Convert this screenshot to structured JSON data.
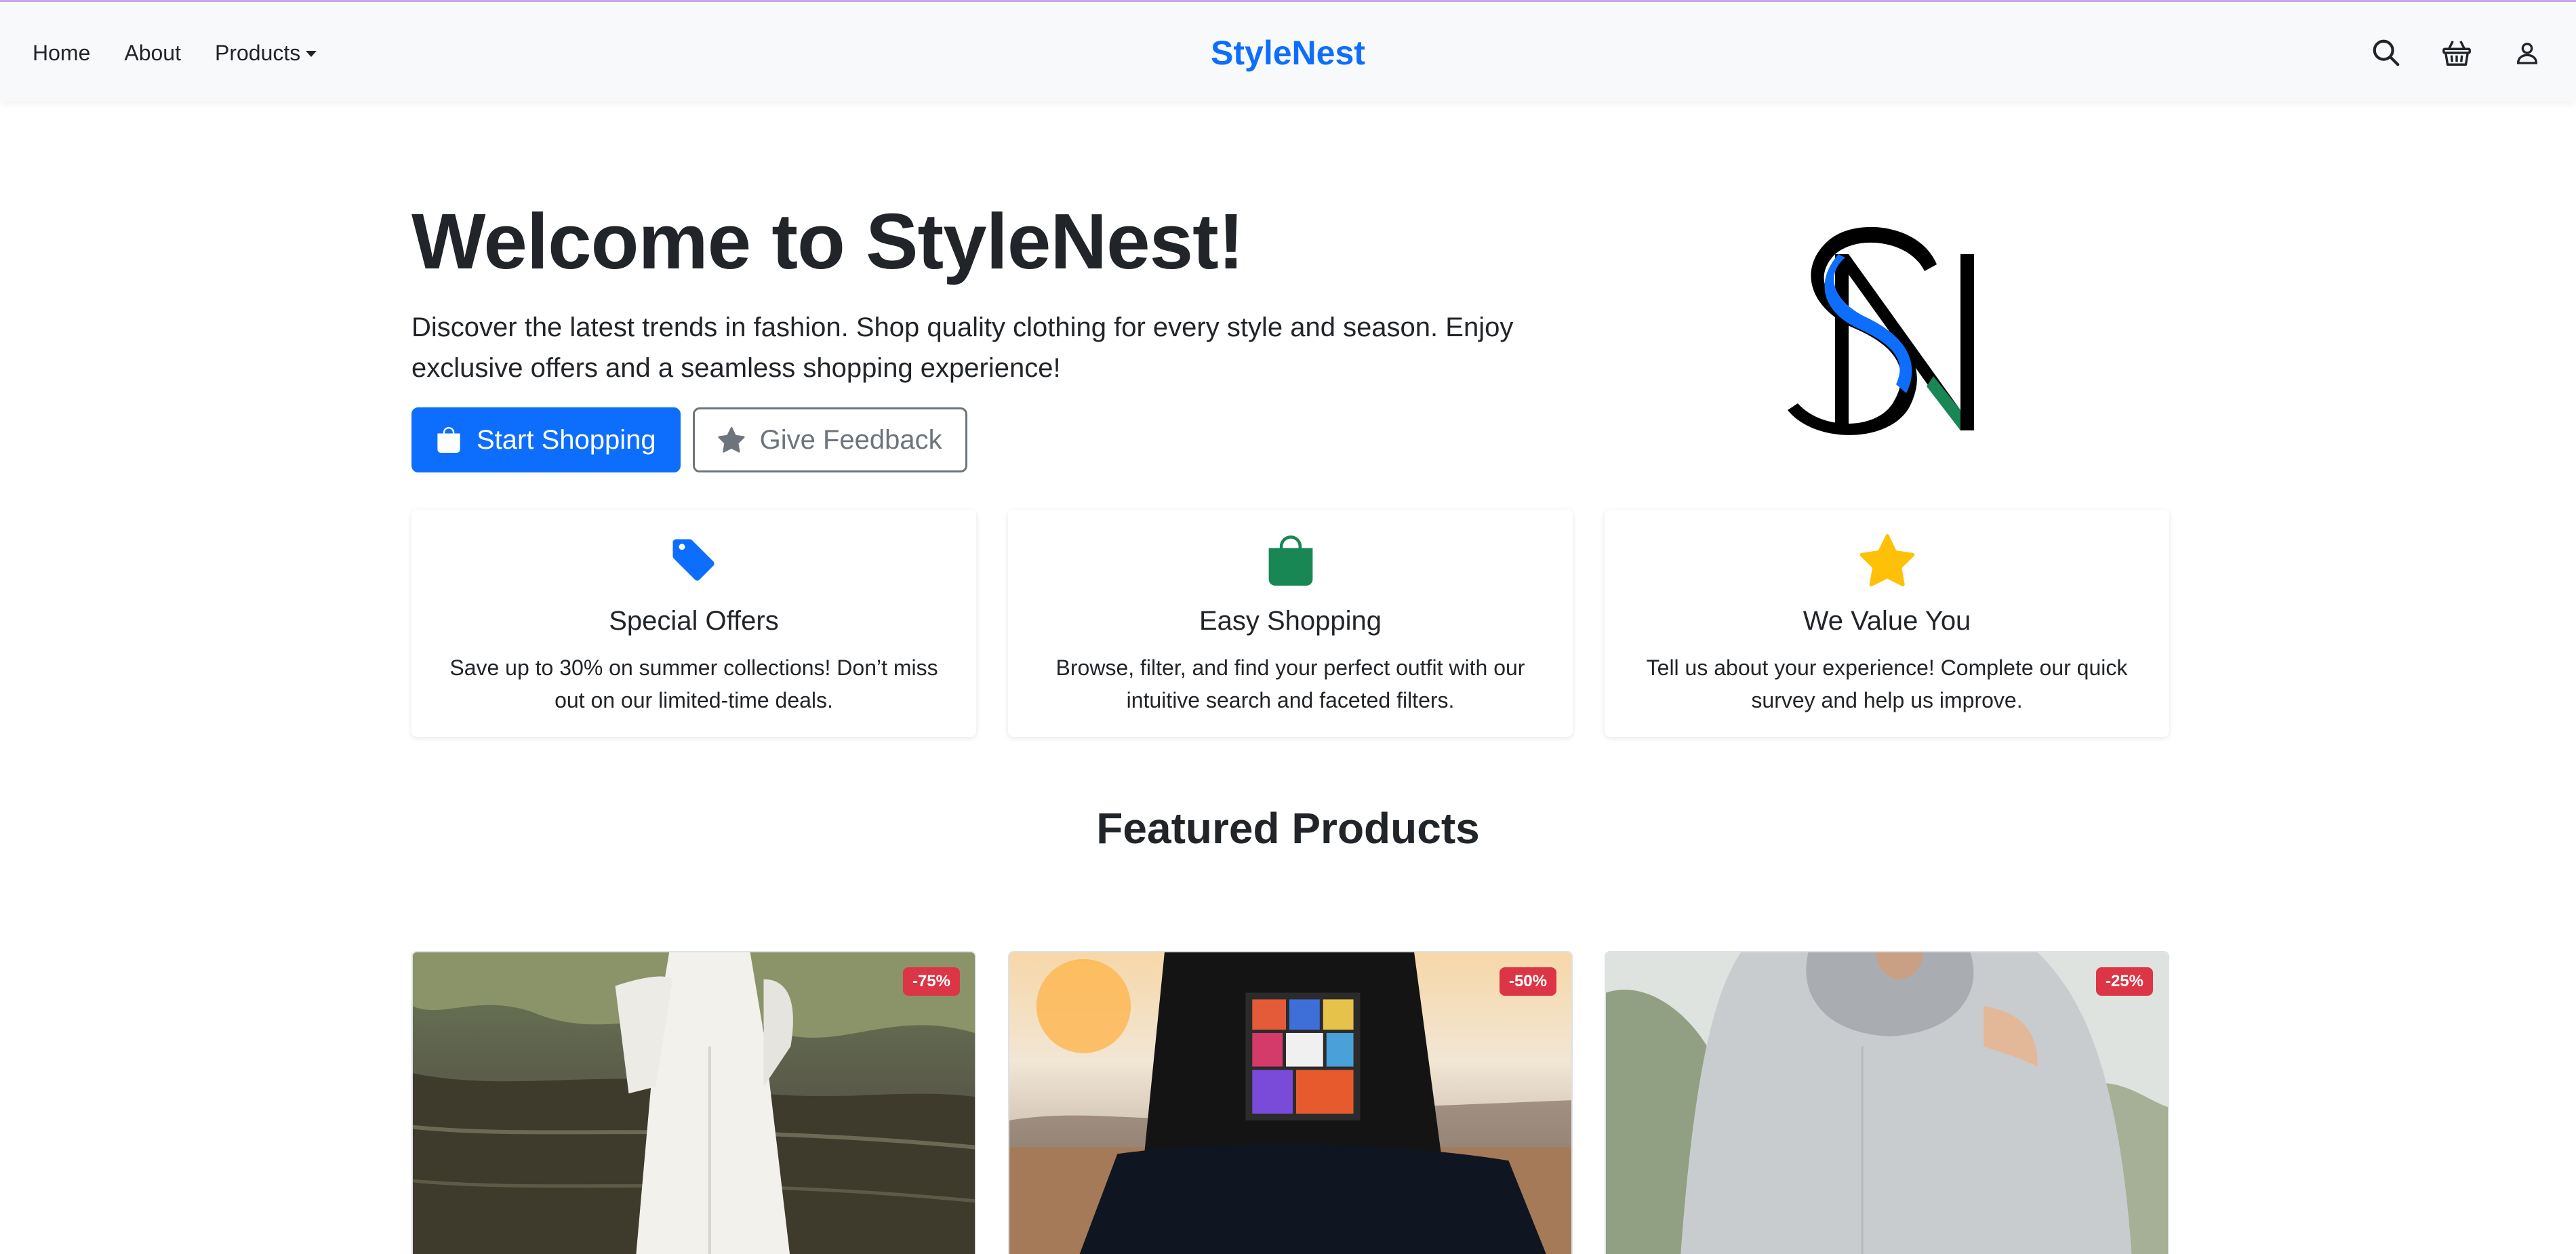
{
  "nav": {
    "links": [
      {
        "label": "Home"
      },
      {
        "label": "About"
      },
      {
        "label": "Products"
      }
    ],
    "brand": "StyleNest",
    "icons": [
      "search-icon",
      "basket-icon",
      "user-icon"
    ]
  },
  "hero": {
    "title": "Welcome to StyleNest!",
    "lead": "Discover the latest trends in fashion. Shop quality clothing for every style and season. Enjoy exclusive offers and a seamless shopping experience!",
    "primary_button": "Start Shopping",
    "secondary_button": "Give Feedback",
    "logo_letters": "SN"
  },
  "features": [
    {
      "icon": "tag-icon",
      "color": "#0d6efd",
      "title": "Special Offers",
      "text": "Save up to 30% on summer collections! Don’t miss out on our limited-time deals."
    },
    {
      "icon": "bag-icon",
      "color": "#198754",
      "title": "Easy Shopping",
      "text": "Browse, filter, and find your perfect outfit with our intuitive search and faceted filters."
    },
    {
      "icon": "star-icon",
      "color": "#ffc107",
      "title": "We Value You",
      "text": "Tell us about your experience! Complete our quick survey and help us improve."
    }
  ],
  "featured": {
    "heading": "Featured Products",
    "products": [
      {
        "image": "white-dress-photo",
        "discount": "-75%"
      },
      {
        "image": "graphic-tshirt-photo",
        "discount": "-50%"
      },
      {
        "image": "grey-hoodie-photo",
        "discount": "-25%"
      }
    ]
  },
  "colors": {
    "primary": "#0d6efd",
    "success": "#198754",
    "warning": "#ffc107",
    "danger": "#dc3545",
    "navbar_bg": "#f8f9fa"
  }
}
